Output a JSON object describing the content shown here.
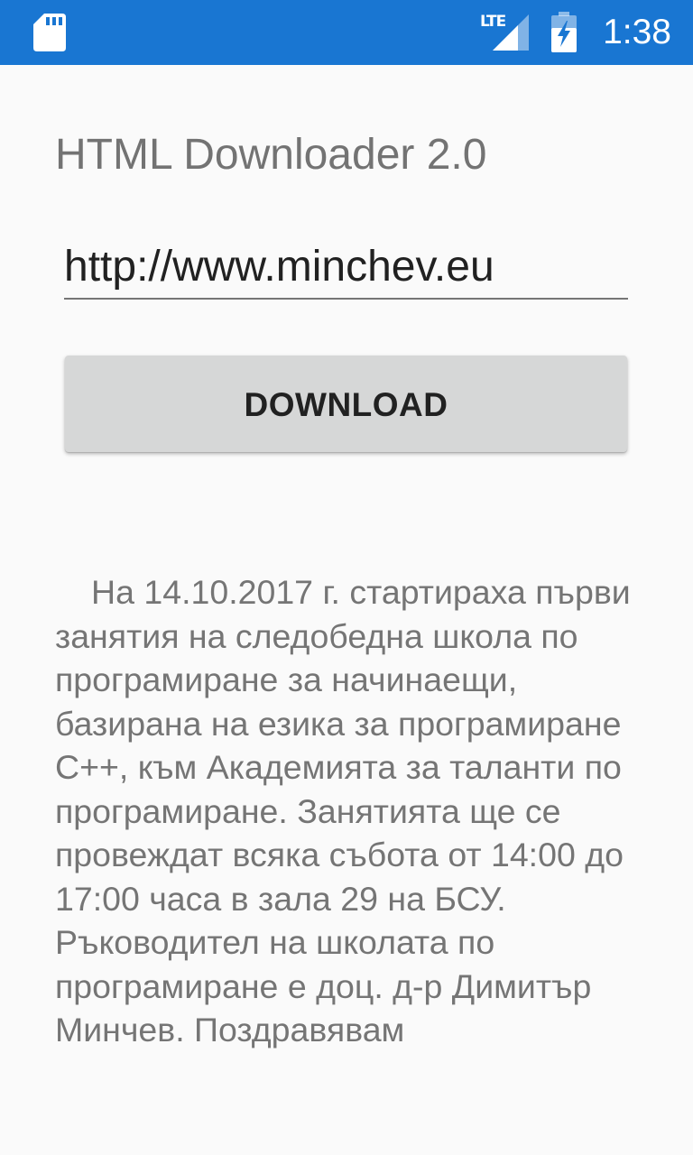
{
  "status_bar": {
    "background_color": "#1976d2",
    "left_icon": "sd-card-icon",
    "network_label": "LTE",
    "signal_icon": "cell-signal-icon",
    "battery_icon": "battery-charging-icon",
    "time": "1:38"
  },
  "app": {
    "title": "HTML Downloader 2.0",
    "url_value": "http://www.minchev.eu",
    "download_label": "DOWNLOAD",
    "content_text": "На 14.10.2017 г. стартираха първи занятия на следобедна школа по програмиране за начинаещи, базирана на езика за програмиране C++, към Академията за таланти по програмиране. Занятията ще се провеждат всяка събота от 14:00 до 17:00 часа в зала 29 на БСУ. Ръководител на школата по програмиране е доц. д-р Димитър Минчев. Поздравявам"
  }
}
